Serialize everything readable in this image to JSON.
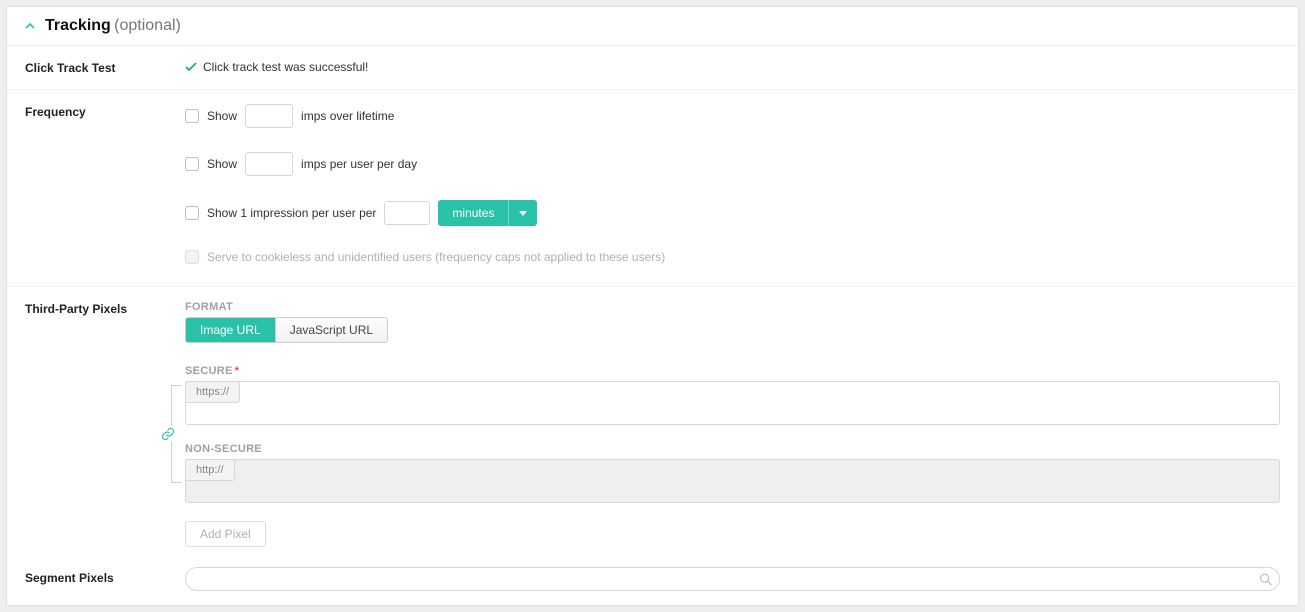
{
  "header": {
    "title": "Tracking",
    "suffix": "(optional)"
  },
  "click_track": {
    "label": "Click Track Test",
    "message": "Click track test was successful!"
  },
  "frequency": {
    "label": "Frequency",
    "rows": {
      "lifetime": {
        "prefix": "Show",
        "value": "",
        "suffix": "imps over lifetime"
      },
      "per_day": {
        "prefix": "Show",
        "value": "",
        "suffix": "imps per user per day"
      },
      "per_interval": {
        "prefix": "Show 1 impression per user per",
        "value": "",
        "dropdown_label": "minutes"
      }
    },
    "cookieless_text": "Serve to cookieless and unidentified users (frequency caps not applied to these users)"
  },
  "third_party": {
    "label": "Third-Party Pixels",
    "format_head": "FORMAT",
    "format_options": {
      "image": "Image URL",
      "js": "JavaScript URL"
    },
    "secure_head": "SECURE",
    "secure_proto": "https://",
    "nonsecure_head": "NON-SECURE",
    "nonsecure_proto": "http://",
    "add_pixel": "Add Pixel"
  },
  "segment": {
    "label": "Segment Pixels",
    "placeholder": ""
  },
  "colors": {
    "accent": "#29c2a9",
    "success": "#27ae60"
  }
}
